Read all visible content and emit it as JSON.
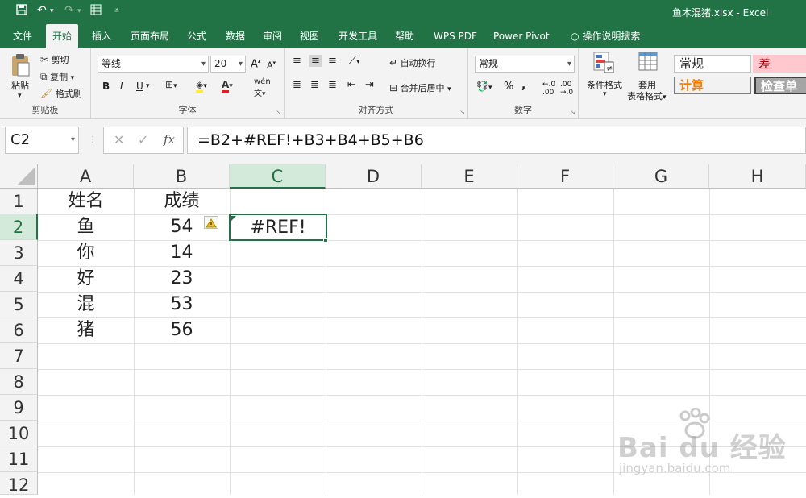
{
  "title_bar": {
    "filename": "鱼木混猪.xlsx",
    "app": "Excel",
    "qat_icons": [
      "save-icon",
      "undo-icon",
      "redo-icon",
      "form-icon",
      "customize-icon"
    ]
  },
  "tabs": [
    "文件",
    "开始",
    "插入",
    "页面布局",
    "公式",
    "数据",
    "审阅",
    "视图",
    "开发工具",
    "帮助",
    "WPS PDF",
    "Power Pivot",
    "操作说明搜索"
  ],
  "active_tab": "开始",
  "ribbon": {
    "clipboard": {
      "paste": "粘贴",
      "cut": "剪切",
      "copy": "复制",
      "format_painter": "格式刷",
      "label": "剪贴板"
    },
    "font": {
      "name": "等线",
      "size": "20",
      "label": "字体",
      "grow": "A",
      "shrink": "A",
      "bold": "B",
      "italic": "I",
      "underline": "U"
    },
    "alignment": {
      "wrap": "自动换行",
      "merge": "合并后居中",
      "label": "对齐方式"
    },
    "number": {
      "format": "常规",
      "percent": "%",
      "comma": ",",
      "label": "数字"
    },
    "styles": {
      "conditional": "条件格式",
      "table_format_1": "套用",
      "table_format_2": "表格格式",
      "normal": "常规",
      "bad": "差",
      "calc": "计算",
      "check": "检查单"
    }
  },
  "formula_bar": {
    "name_box": "C2",
    "formula": "=B2+#REF!+B3+B4+B5+B6"
  },
  "columns": [
    "A",
    "B",
    "C",
    "D",
    "E",
    "F",
    "G",
    "H"
  ],
  "rows": [
    "1",
    "2",
    "3",
    "4",
    "5",
    "6",
    "7",
    "8",
    "9",
    "10",
    "11",
    "12"
  ],
  "cells": {
    "A1": "姓名",
    "B1": "成绩",
    "A2": "鱼",
    "B2": "54",
    "C2": "#REF!",
    "A3": "你",
    "B3": "14",
    "A4": "好",
    "B4": "23",
    "A5": "混",
    "B5": "53",
    "A6": "猪",
    "B6": "56"
  },
  "colors": {
    "accent": "#217346",
    "selected_header": "#d3e9d9"
  },
  "watermark": {
    "brand": "Bai du 经验",
    "url": "jingyan.baidu.com"
  }
}
